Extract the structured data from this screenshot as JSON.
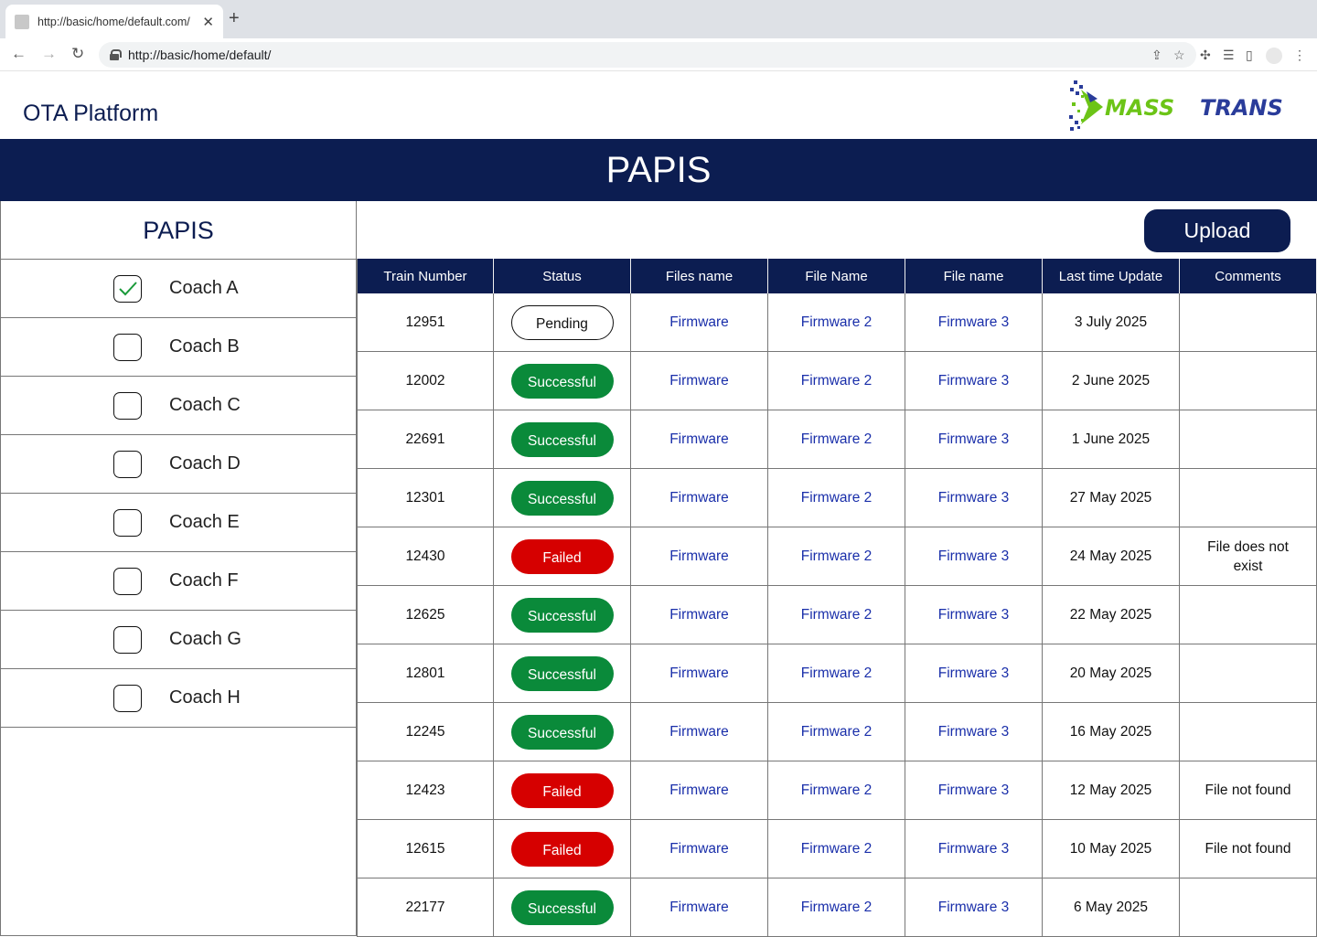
{
  "browser": {
    "tab_title": "http://basic/home/default.com/",
    "url": "http://basic/home/default/"
  },
  "header": {
    "app_title": "OTA Platform",
    "logo_text": "MASSTRANS",
    "banner_title": "PAPIS"
  },
  "sidebar": {
    "title": "PAPIS",
    "coaches": [
      {
        "label": "Coach A",
        "checked": true
      },
      {
        "label": "Coach B",
        "checked": false
      },
      {
        "label": "Coach C",
        "checked": false
      },
      {
        "label": "Coach D",
        "checked": false
      },
      {
        "label": "Coach E",
        "checked": false
      },
      {
        "label": "Coach F",
        "checked": false
      },
      {
        "label": "Coach G",
        "checked": false
      },
      {
        "label": "Coach H",
        "checked": false
      }
    ]
  },
  "main": {
    "upload_label": "Upload",
    "columns": [
      "Train Number",
      "Status",
      "Files name",
      "File Name",
      "File name",
      "Last time Update",
      "Comments"
    ],
    "rows": [
      {
        "train": "12951",
        "status": "Pending",
        "file1": "Firmware",
        "file2": "Firmware 2",
        "file3": "Firmware 3",
        "updated": "3 July 2025",
        "comment": ""
      },
      {
        "train": "12002",
        "status": "Successful",
        "file1": "Firmware",
        "file2": "Firmware 2",
        "file3": "Firmware 3",
        "updated": "2 June 2025",
        "comment": ""
      },
      {
        "train": "22691",
        "status": "Successful",
        "file1": "Firmware",
        "file2": "Firmware 2",
        "file3": "Firmware 3",
        "updated": "1 June 2025",
        "comment": ""
      },
      {
        "train": "12301",
        "status": "Successful",
        "file1": "Firmware",
        "file2": "Firmware 2",
        "file3": "Firmware 3",
        "updated": "27 May 2025",
        "comment": ""
      },
      {
        "train": "12430",
        "status": "Failed",
        "file1": "Firmware",
        "file2": "Firmware 2",
        "file3": "Firmware 3",
        "updated": "24 May 2025",
        "comment": "File does not exist"
      },
      {
        "train": "12625",
        "status": "Successful",
        "file1": "Firmware",
        "file2": "Firmware 2",
        "file3": "Firmware 3",
        "updated": "22 May 2025",
        "comment": ""
      },
      {
        "train": "12801",
        "status": "Successful",
        "file1": "Firmware",
        "file2": "Firmware 2",
        "file3": "Firmware 3",
        "updated": "20 May 2025",
        "comment": ""
      },
      {
        "train": "12245",
        "status": "Successful",
        "file1": "Firmware",
        "file2": "Firmware 2",
        "file3": "Firmware 3",
        "updated": "16 May 2025",
        "comment": ""
      },
      {
        "train": "12423",
        "status": "Failed",
        "file1": "Firmware",
        "file2": "Firmware 2",
        "file3": "Firmware 3",
        "updated": "12 May 2025",
        "comment": "File not found"
      },
      {
        "train": "12615",
        "status": "Failed",
        "file1": "Firmware",
        "file2": "Firmware 2",
        "file3": "Firmware 3",
        "updated": "10 May 2025",
        "comment": "File not found"
      },
      {
        "train": "22177",
        "status": "Successful",
        "file1": "Firmware",
        "file2": "Firmware 2",
        "file3": "Firmware 3",
        "updated": "6 May 2025",
        "comment": ""
      }
    ]
  },
  "colors": {
    "navy": "#0c1d51",
    "success": "#0a8a3a",
    "failed": "#d60000",
    "link": "#1a2faa",
    "logo_green": "#6cc417"
  },
  "icons": [
    "back-arrow-icon",
    "forward-arrow-icon",
    "reload-icon",
    "lock-icon",
    "share-icon",
    "star-icon",
    "extensions-icon",
    "reading-list-icon",
    "side-panel-icon",
    "menu-icon",
    "check-icon"
  ]
}
